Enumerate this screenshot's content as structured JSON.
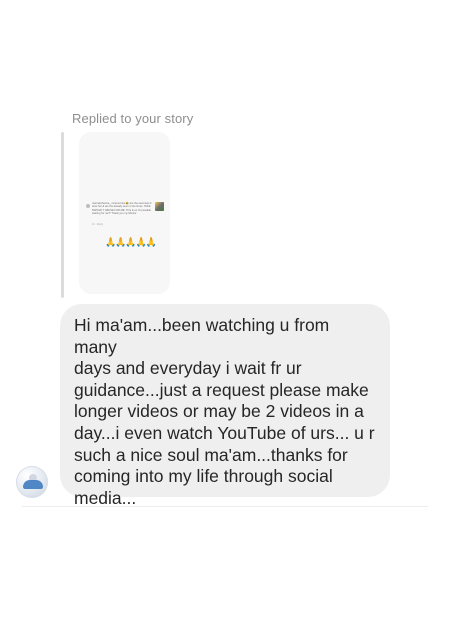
{
  "reply": {
    "label": "Replied to your story"
  },
  "story_preview": {
    "text": "marnaksharma_ curious kiss 😂 are the exercises below her & are the already seen in the limes. TAKE 5025 ED T ABUSE FOR ME: Thru & ex Or possible starting for me?! Thank you my Mentor",
    "meta": "1h · Reply",
    "emojis": "🙏🙏🙏🙏🙏"
  },
  "message": {
    "text": "Hi ma'am...been watching u from many\ndays and everyday i wait fr ur\nguidance...just a request please make\nlonger videos or may be 2 videos in a\nday...i even watch YouTube of urs... u r\nsuch a nice soul ma'am...thanks for\ncoming into my life through social\nmedia..."
  },
  "colors": {
    "bubble_bg": "#efefef",
    "text": "#262626",
    "secondary_text": "#8e8e8e",
    "quote_bar": "#dbdbdb"
  },
  "icons": {
    "avatar": "profile-avatar"
  }
}
